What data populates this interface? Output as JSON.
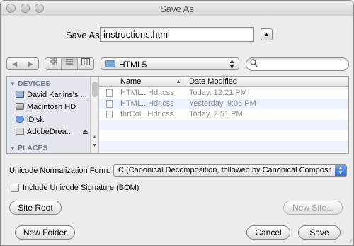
{
  "window": {
    "title": "Save As"
  },
  "save_as": {
    "label": "Save As:",
    "filename": "instructions.html"
  },
  "toolbar": {
    "back_glyph": "◀",
    "forward_glyph": "▶",
    "folder": "HTML5",
    "search_placeholder": ""
  },
  "sidebar": {
    "devices_header": "DEVICES",
    "places_header": "PLACES",
    "items": [
      {
        "label": "David Karlins's ...",
        "icon": "laptop-icon"
      },
      {
        "label": "Macintosh HD",
        "icon": "hard-drive-icon"
      },
      {
        "label": "iDisk",
        "icon": "idisk-icon"
      },
      {
        "label": "AdobeDrea...",
        "icon": "drive-icon"
      }
    ]
  },
  "file_list": {
    "col_name": "Name",
    "col_date": "Date Modified",
    "rows": [
      {
        "name": "HTML...Hdr.css",
        "date": "Today, 12:21 PM"
      },
      {
        "name": "HTML...Hdr.css",
        "date": "Yesterday, 9:06 PM"
      },
      {
        "name": "thrCol...Hdr.css",
        "date": "Today, 2:51 PM"
      }
    ]
  },
  "options": {
    "normalization_label": "Unicode Normalization Form:",
    "normalization_value": "C (Canonical Decomposition, followed by Canonical Compositi...",
    "bom_label": "Include Unicode Signature (BOM)",
    "bom_checked": false
  },
  "buttons": {
    "site_root": "Site Root",
    "new_site": "New Site...",
    "new_folder": "New Folder",
    "cancel": "Cancel",
    "save": "Save"
  }
}
